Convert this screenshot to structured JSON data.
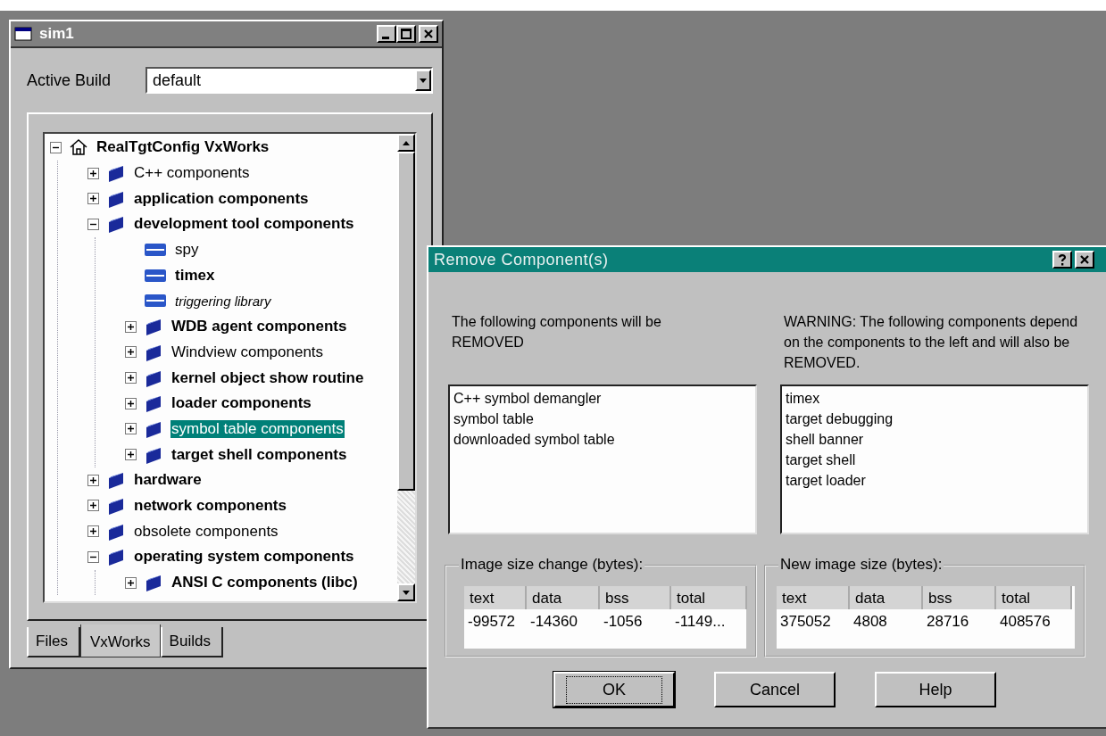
{
  "main_window": {
    "title": "sim1",
    "active_build": {
      "label": "Active Build",
      "value": "default"
    },
    "tree": [
      {
        "label": "RealTgtConfig VxWorks",
        "kind": "root",
        "included": true,
        "installed": true,
        "expanded": true,
        "selected": false,
        "children": [
          {
            "label": "C++ components",
            "kind": "folder",
            "included": false,
            "installed": true,
            "expanded": false,
            "selected": false
          },
          {
            "label": "application components",
            "kind": "folder",
            "included": true,
            "installed": true,
            "expanded": false,
            "selected": false
          },
          {
            "label": "development tool components",
            "kind": "folder",
            "included": true,
            "installed": true,
            "expanded": true,
            "selected": false,
            "children": [
              {
                "label": "spy",
                "kind": "component",
                "included": false,
                "installed": true,
                "selected": false
              },
              {
                "label": "timex",
                "kind": "component",
                "included": true,
                "installed": true,
                "selected": false
              },
              {
                "label": "triggering library",
                "kind": "component",
                "included": false,
                "installed": false,
                "selected": false
              },
              {
                "label": "WDB agent components",
                "kind": "folder",
                "included": true,
                "installed": true,
                "expanded": false,
                "selected": false
              },
              {
                "label": "Windview components",
                "kind": "folder",
                "included": false,
                "installed": true,
                "expanded": false,
                "selected": false
              },
              {
                "label": "kernel object show routine",
                "kind": "folder",
                "included": true,
                "installed": true,
                "expanded": false,
                "selected": false
              },
              {
                "label": "loader components",
                "kind": "folder",
                "included": true,
                "installed": true,
                "expanded": false,
                "selected": false
              },
              {
                "label": "symbol table components",
                "kind": "folder",
                "included": false,
                "installed": true,
                "expanded": false,
                "selected": true
              },
              {
                "label": "target shell components",
                "kind": "folder",
                "included": true,
                "installed": true,
                "expanded": false,
                "selected": false
              }
            ]
          },
          {
            "label": "hardware",
            "kind": "folder",
            "included": true,
            "installed": true,
            "expanded": false,
            "selected": false
          },
          {
            "label": "network components",
            "kind": "folder",
            "included": true,
            "installed": true,
            "expanded": false,
            "selected": false
          },
          {
            "label": "obsolete components",
            "kind": "folder",
            "included": false,
            "installed": true,
            "expanded": false,
            "selected": false
          },
          {
            "label": "operating system components",
            "kind": "folder",
            "included": true,
            "installed": true,
            "expanded": true,
            "selected": false,
            "children": [
              {
                "label": "ANSI C components (libc)",
                "kind": "folder",
                "included": true,
                "installed": true,
                "expanded": false,
                "selected": false
              }
            ]
          }
        ]
      }
    ],
    "tabs": [
      {
        "label": "Files",
        "selected": false
      },
      {
        "label": "VxWorks",
        "selected": true
      },
      {
        "label": "Builds",
        "selected": false
      }
    ]
  },
  "dialog": {
    "title": "Remove Component(s)",
    "removed": {
      "description": "The following components will be REMOVED",
      "items": [
        "C++ symbol demangler",
        "symbol table",
        "downloaded symbol table"
      ]
    },
    "dependents": {
      "description": "WARNING: The following components depend on the components to the left and will also be REMOVED.",
      "items": [
        "timex",
        "target debugging",
        "shell banner",
        "target shell",
        "target loader"
      ]
    },
    "size_change": {
      "title": "Image size change (bytes):",
      "columns": [
        "text",
        "data",
        "bss",
        "total"
      ],
      "rows": [
        [
          "-99572",
          "-14360",
          "-1056",
          "-1149..."
        ]
      ]
    },
    "new_size": {
      "title": "New image size (bytes):",
      "columns": [
        "text",
        "data",
        "bss",
        "total"
      ],
      "rows": [
        [
          "375052",
          "4808",
          "28716",
          "408576"
        ]
      ]
    },
    "buttons": [
      {
        "label": "OK",
        "default": true
      },
      {
        "label": "Cancel",
        "default": false
      },
      {
        "label": "Help",
        "default": false
      }
    ]
  }
}
